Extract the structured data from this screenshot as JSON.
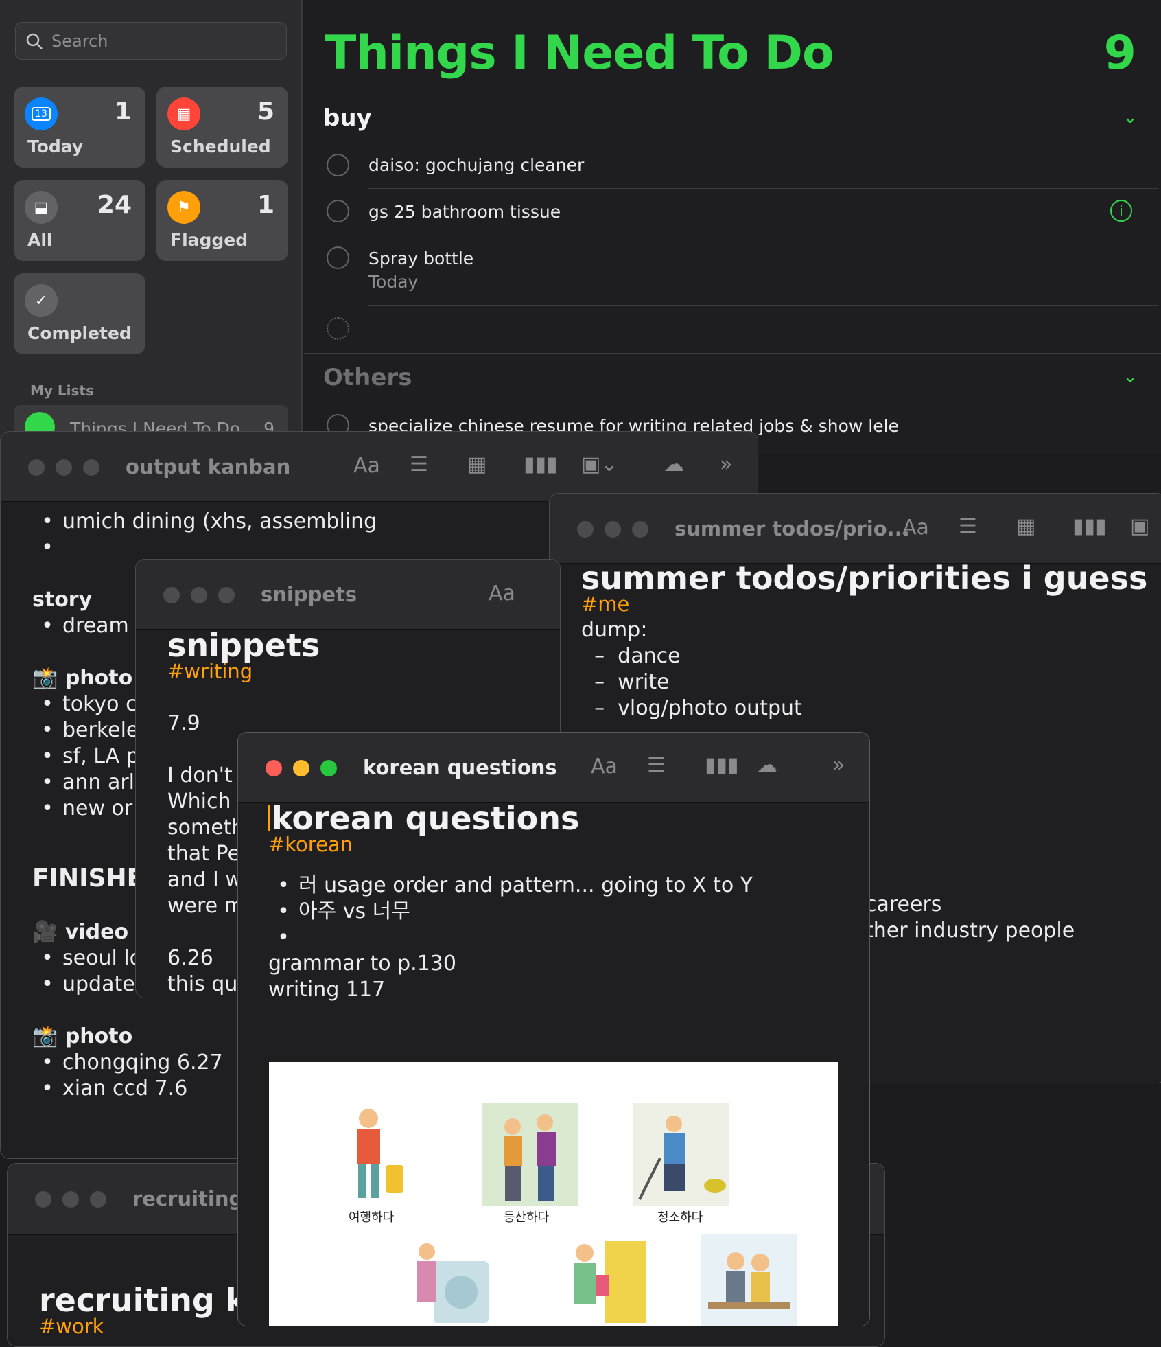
{
  "reminders": {
    "search_placeholder": "Search",
    "tiles": [
      {
        "label": "Today",
        "count": "1",
        "icon": "calendar-icon",
        "color": "#0a84ff"
      },
      {
        "label": "Scheduled",
        "count": "5",
        "icon": "calendar-grid-icon",
        "color": "#ff453a"
      },
      {
        "label": "All",
        "count": "24",
        "icon": "tray-icon",
        "color": "#636366"
      },
      {
        "label": "Flagged",
        "count": "1",
        "icon": "flag-icon",
        "color": "#ff9f0a"
      },
      {
        "label": "Completed",
        "count": "",
        "icon": "checkmark-icon",
        "color": "#636366"
      }
    ],
    "today_day": "13",
    "my_lists_label": "My Lists",
    "list_name": "Things I Need To Do",
    "list_count": "9",
    "title": "Things I Need To Do",
    "count": "9",
    "sections": [
      {
        "name": "buy",
        "items": [
          {
            "title": "daiso: gochujang cleaner",
            "sub": ""
          },
          {
            "title": "gs 25 bathroom tissue",
            "sub": ""
          },
          {
            "title": "Spray bottle",
            "sub": "Today"
          }
        ]
      },
      {
        "name": "Others",
        "items": [
          {
            "title": "specialize chinese resume for writing related jobs & show lele",
            "sub": ""
          }
        ]
      }
    ],
    "accent": "#32d74b"
  },
  "notes": {
    "kanban": {
      "title": "output kanban",
      "lines": [
        "umich dining (xhs, assembling",
        "",
        "story",
        "dream",
        "photo",
        "tokyo c",
        "berkele",
        "sf, LA p",
        "ann arl",
        "new or",
        "FINISHE",
        "video",
        "seoul lo",
        "update personal v",
        "photo",
        "chongqing 6.27",
        "xian ccd  7.6"
      ]
    },
    "summer": {
      "title": "summer todos/prio...",
      "heading": "summer todos/priorities i guess",
      "tag": "#me",
      "lines": [
        "dump:",
        "dance",
        "write",
        "vlog/photo output",
        "careers",
        "ther industry people"
      ]
    },
    "snippets": {
      "title": "snippets",
      "heading": "snippets",
      "tag": "#writing",
      "lines": [
        "7.9",
        "I don't v",
        "Which t",
        "someth",
        "that Pe",
        "and I w",
        "were m",
        "6.26",
        "this que"
      ]
    },
    "recruiting": {
      "title": "recruiting k",
      "heading": "recruiting kar",
      "tag": "#work"
    },
    "korean": {
      "title": "korean questions",
      "heading": "korean questions",
      "tag": "#korean",
      "bullets": [
        "러 usage order and pattern... going to X to Y",
        "아주 vs 너무",
        ""
      ],
      "lines": [
        "grammar to p.130",
        "writing 117"
      ],
      "image_captions": [
        "여행하다",
        "등산하다",
        "청소하다"
      ]
    },
    "toolbar": {
      "font": "Aa",
      "more": "»"
    }
  }
}
